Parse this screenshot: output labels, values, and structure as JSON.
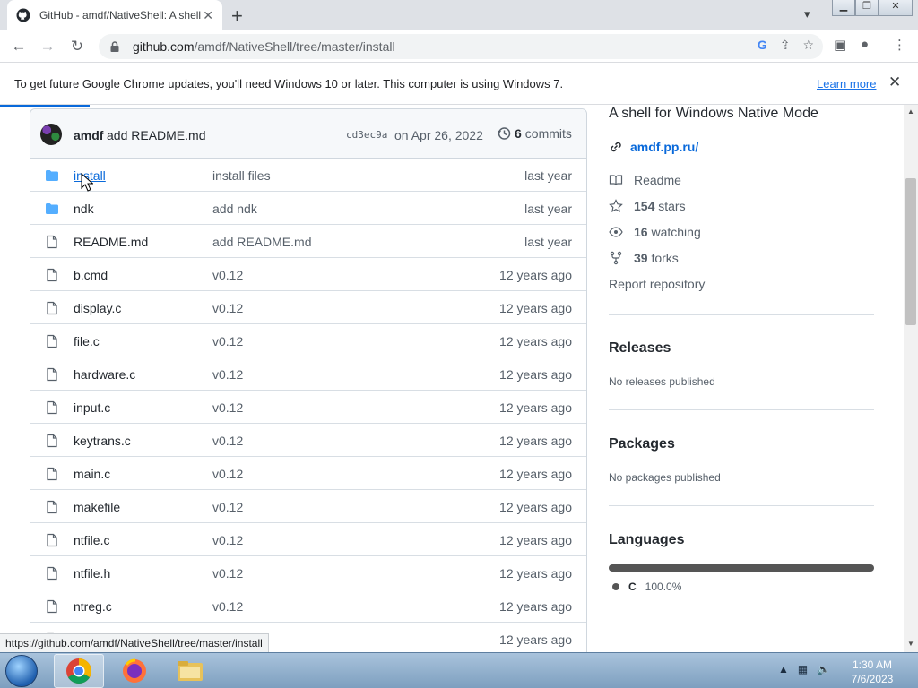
{
  "browser": {
    "tab_title": "GitHub - amdf/NativeShell: A shell for Windows Native Mode",
    "tab_close": "✕",
    "new_tab": "+",
    "url_host": "github.com",
    "url_path": "/amdf/NativeShell/tree/master/install",
    "status_url": "https://github.com/amdf/NativeShell/tree/master/install"
  },
  "infobar": {
    "message": "To get future Google Chrome updates, you'll need Windows 10 or later. This computer is using Windows 7.",
    "learn_more": "Learn more"
  },
  "commit": {
    "author": "amdf",
    "message": "add README.md",
    "sha": "cd3ec9a",
    "date": "on Apr 26, 2022",
    "count": "6",
    "count_label": "commits"
  },
  "files": [
    {
      "name": "install",
      "type": "dir",
      "message": "install files",
      "age": "last year"
    },
    {
      "name": "ndk",
      "type": "dir",
      "message": "add ndk",
      "age": "last year"
    },
    {
      "name": "README.md",
      "type": "file",
      "message": "add README.md",
      "age": "last year"
    },
    {
      "name": "b.cmd",
      "type": "file",
      "message": "v0.12",
      "age": "12 years ago"
    },
    {
      "name": "display.c",
      "type": "file",
      "message": "v0.12",
      "age": "12 years ago"
    },
    {
      "name": "file.c",
      "type": "file",
      "message": "v0.12",
      "age": "12 years ago"
    },
    {
      "name": "hardware.c",
      "type": "file",
      "message": "v0.12",
      "age": "12 years ago"
    },
    {
      "name": "input.c",
      "type": "file",
      "message": "v0.12",
      "age": "12 years ago"
    },
    {
      "name": "keytrans.c",
      "type": "file",
      "message": "v0.12",
      "age": "12 years ago"
    },
    {
      "name": "main.c",
      "type": "file",
      "message": "v0.12",
      "age": "12 years ago"
    },
    {
      "name": "makefile",
      "type": "file",
      "message": "v0.12",
      "age": "12 years ago"
    },
    {
      "name": "ntfile.c",
      "type": "file",
      "message": "v0.12",
      "age": "12 years ago"
    },
    {
      "name": "ntfile.h",
      "type": "file",
      "message": "v0.12",
      "age": "12 years ago"
    },
    {
      "name": "ntreg.c",
      "type": "file",
      "message": "v0.12",
      "age": "12 years ago"
    },
    {
      "name": "",
      "type": "file",
      "message": "",
      "age": "12 years ago"
    }
  ],
  "about": {
    "description": "A shell for Windows Native Mode",
    "website": "amdf.pp.ru/",
    "readme": "Readme",
    "stars_count": "154",
    "stars_label": "stars",
    "watching_count": "16",
    "watching_label": "watching",
    "forks_count": "39",
    "forks_label": "forks",
    "report": "Report repository"
  },
  "releases": {
    "title": "Releases",
    "note": "No releases published"
  },
  "packages": {
    "title": "Packages",
    "note": "No packages published"
  },
  "languages": {
    "title": "Languages",
    "items": [
      {
        "name": "C",
        "percent": "100.0%",
        "color": "#555555"
      }
    ]
  },
  "taskbar": {
    "time": "1:30 AM",
    "date": "7/6/2023"
  },
  "colors": {
    "link": "#0969da",
    "folder": "#54aeff",
    "chrome_blue": "#1a73e8"
  }
}
